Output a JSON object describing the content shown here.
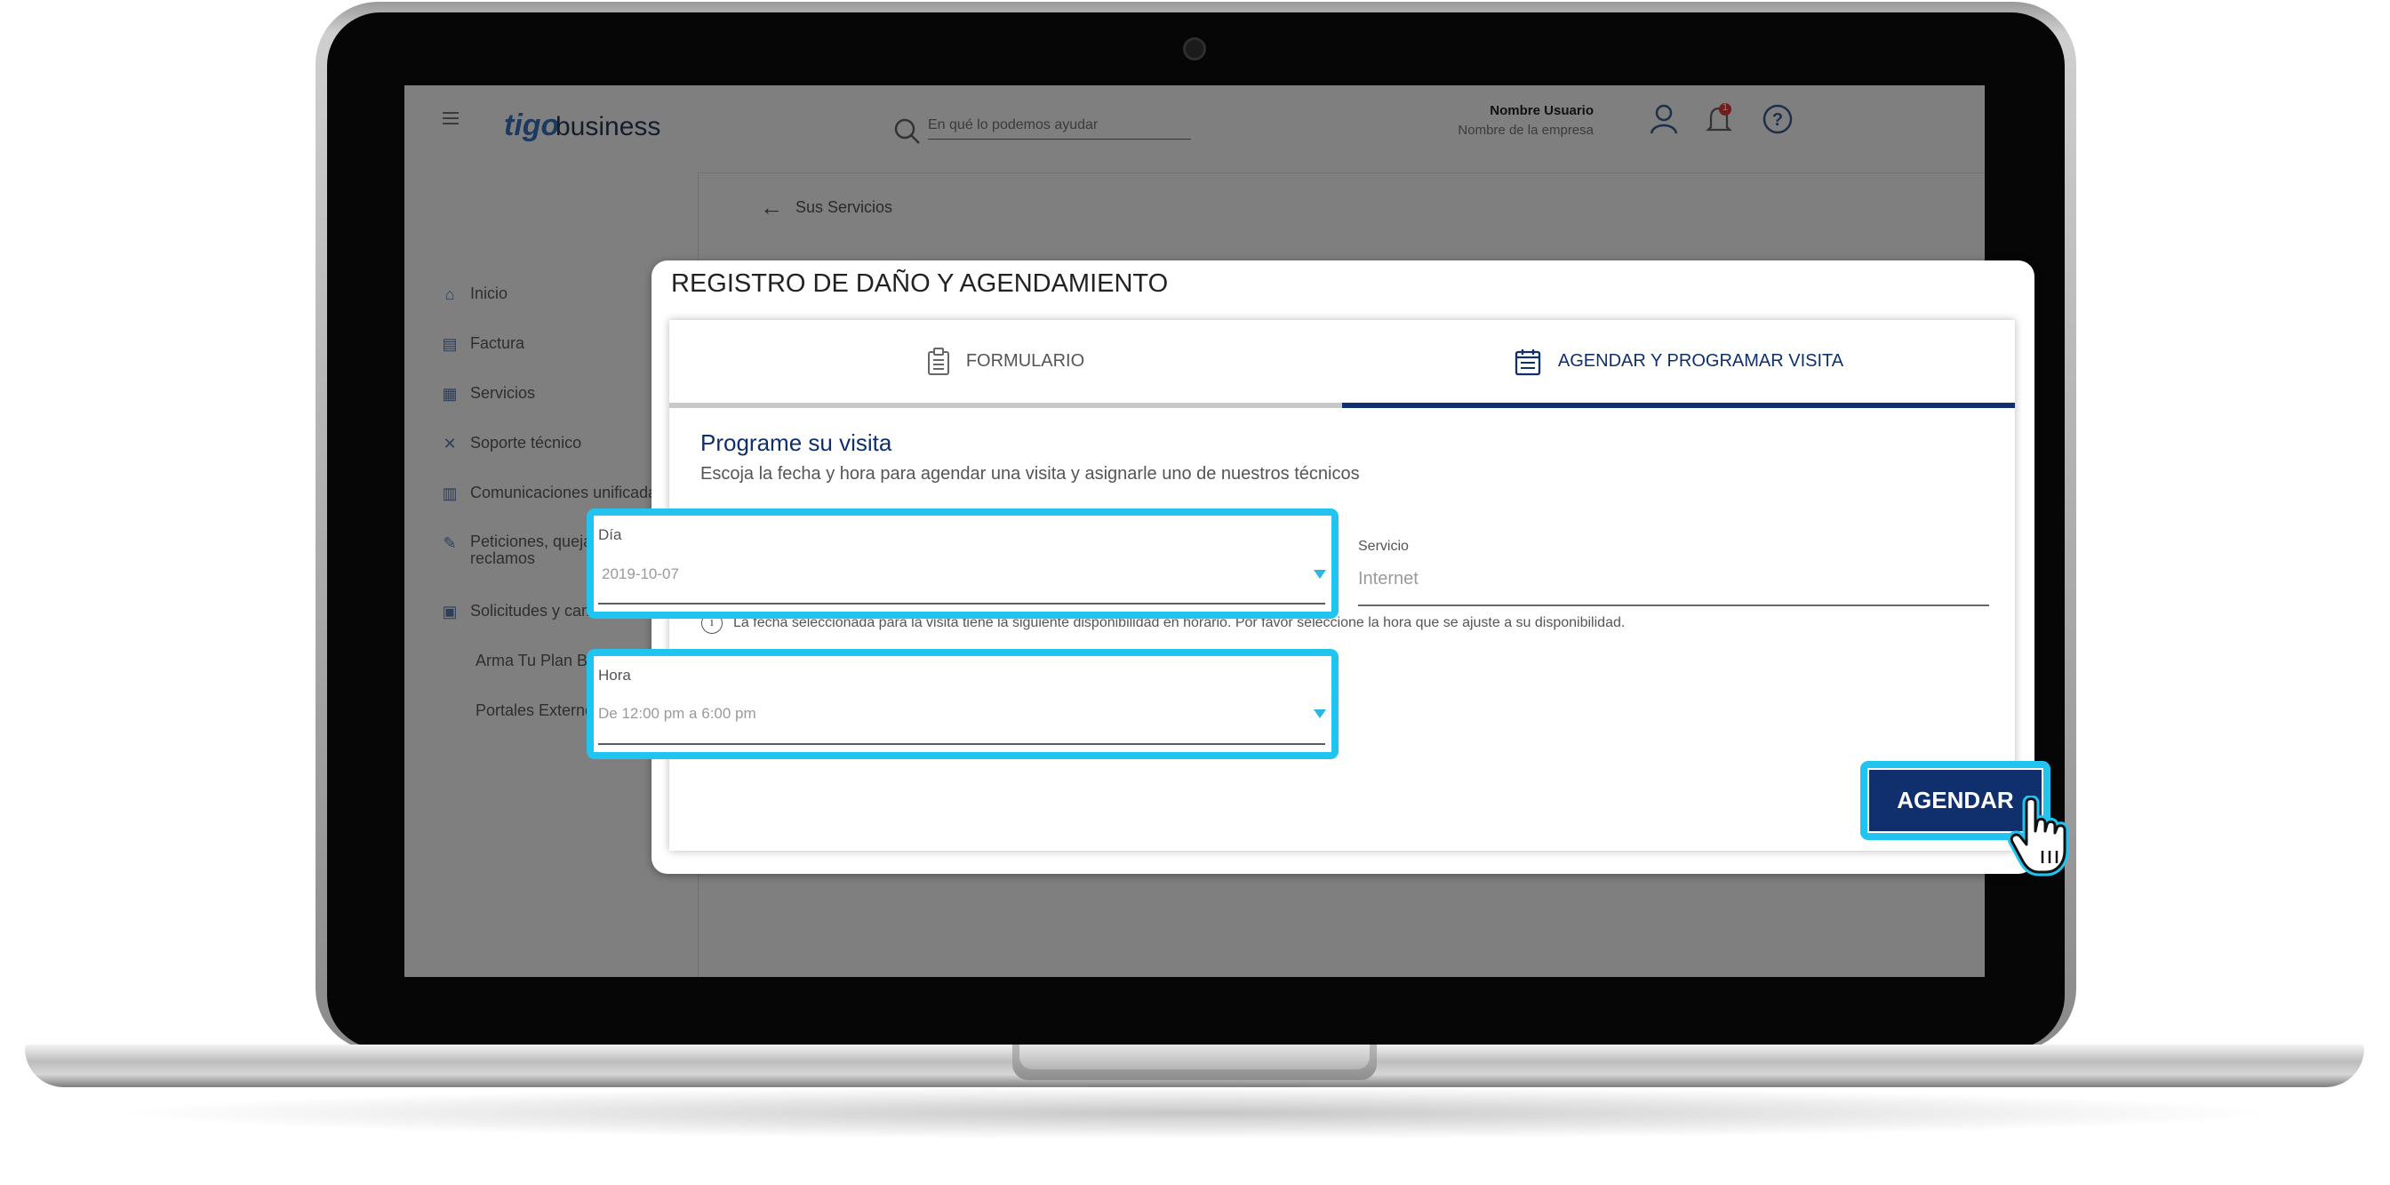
{
  "header": {
    "logo_tigo": "tigo",
    "logo_business": "business",
    "search_placeholder": "En qué lo podemos ayudar",
    "user_name": "Nombre Usuario",
    "company_name": "Nombre de la empresa",
    "notification_count": "1"
  },
  "sidebar": {
    "items": [
      {
        "label": "Inicio",
        "icon": "home-icon"
      },
      {
        "label": "Factura",
        "icon": "invoice-icon"
      },
      {
        "label": "Servicios",
        "icon": "grid-icon"
      },
      {
        "label": "Soporte técnico",
        "icon": "tools-icon"
      },
      {
        "label": "Comunicaciones unificadas",
        "icon": "book-icon"
      },
      {
        "label": "Peticiones, quejas y reclamos",
        "icon": "edit-doc-icon"
      },
      {
        "label": "Solicitudes y cambios",
        "icon": "clipboard-icon"
      },
      {
        "label": "Arma Tu Plan Business",
        "icon": ""
      },
      {
        "label": "Portales Externos",
        "icon": ""
      }
    ]
  },
  "breadcrumb": {
    "back_label": "Sus Servicios"
  },
  "modal": {
    "title": "REGISTRO DE DAÑO Y AGENDAMIENTO",
    "tabs": [
      {
        "label": "FORMULARIO",
        "icon": "clipboard-icon",
        "active": false
      },
      {
        "label": "AGENDAR Y PROGRAMAR VISITA",
        "icon": "calendar-icon",
        "active": true
      }
    ],
    "section_title": "Programe su visita",
    "section_subtitle": "Escoja la fecha y hora para agendar una visita y asignarle uno de nuestros técnicos",
    "day_field": {
      "label": "Día",
      "value": "2019-10-07"
    },
    "service_field": {
      "label": "Servicio",
      "value": "Internet"
    },
    "info_text": "La fecha seleccionada para la visita tiene la siguiente disponibilidad en horario. Por favor seleccione la hora que se ajuste a su disponibilidad.",
    "hour_field": {
      "label": "Hora",
      "value": "De 12:00 pm a 6:00 pm"
    },
    "submit_label": "AGENDAR"
  },
  "colors": {
    "primary": "#0f2f6d",
    "highlight": "#21c4ef",
    "accent_caret": "#2ab6e6"
  }
}
